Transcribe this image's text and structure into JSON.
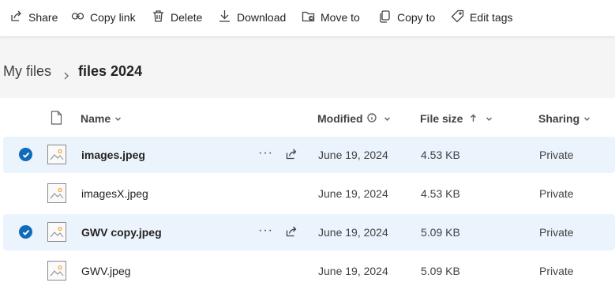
{
  "toolbar": {
    "share": "Share",
    "copy_link": "Copy link",
    "delete": "Delete",
    "download": "Download",
    "move_to": "Move to",
    "copy_to": "Copy to",
    "edit_tags": "Edit tags"
  },
  "breadcrumb": {
    "root": "My files",
    "current": "files 2024"
  },
  "columns": {
    "name": "Name",
    "modified": "Modified",
    "file_size": "File size",
    "sharing": "Sharing"
  },
  "files": [
    {
      "name": "images.jpeg",
      "modified": "June 19, 2024",
      "size": "4.53 KB",
      "sharing": "Private",
      "selected": true
    },
    {
      "name": "imagesX.jpeg",
      "modified": "June 19, 2024",
      "size": "4.53 KB",
      "sharing": "Private",
      "selected": false
    },
    {
      "name": "GWV copy.jpeg",
      "modified": "June 19, 2024",
      "size": "5.09 KB",
      "sharing": "Private",
      "selected": true
    },
    {
      "name": "GWV.jpeg",
      "modified": "June 19, 2024",
      "size": "5.09 KB",
      "sharing": "Private",
      "selected": false
    }
  ],
  "colors": {
    "accent": "#0f6cbd",
    "selected_row": "#ebf3fc",
    "image_sun": "#f7a53a"
  }
}
